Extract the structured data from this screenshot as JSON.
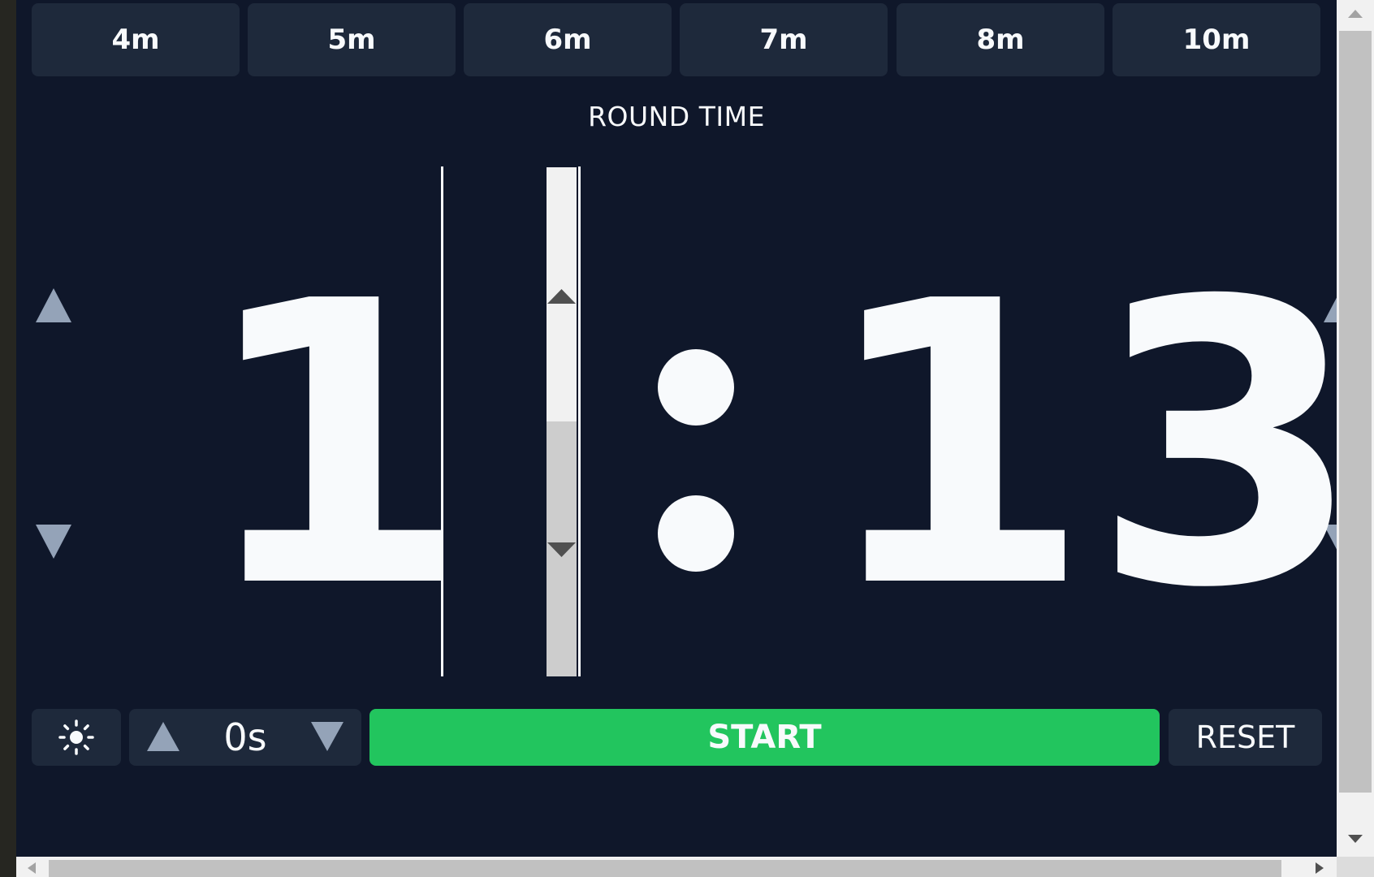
{
  "presets": [
    "4m",
    "5m",
    "6m",
    "7m",
    "8m",
    "10m"
  ],
  "round_time_label": "ROUND TIME",
  "timer": {
    "minutes": "1",
    "seconds": "13"
  },
  "controls": {
    "theme_icon": "sun-icon",
    "offset_value": "0s",
    "start_label": "START",
    "reset_label": "RESET"
  },
  "colors": {
    "background": "#0f172a",
    "panel": "#1e293b",
    "text": "#f8fafc",
    "arrow": "#94a3b8",
    "start": "#22c55e"
  }
}
